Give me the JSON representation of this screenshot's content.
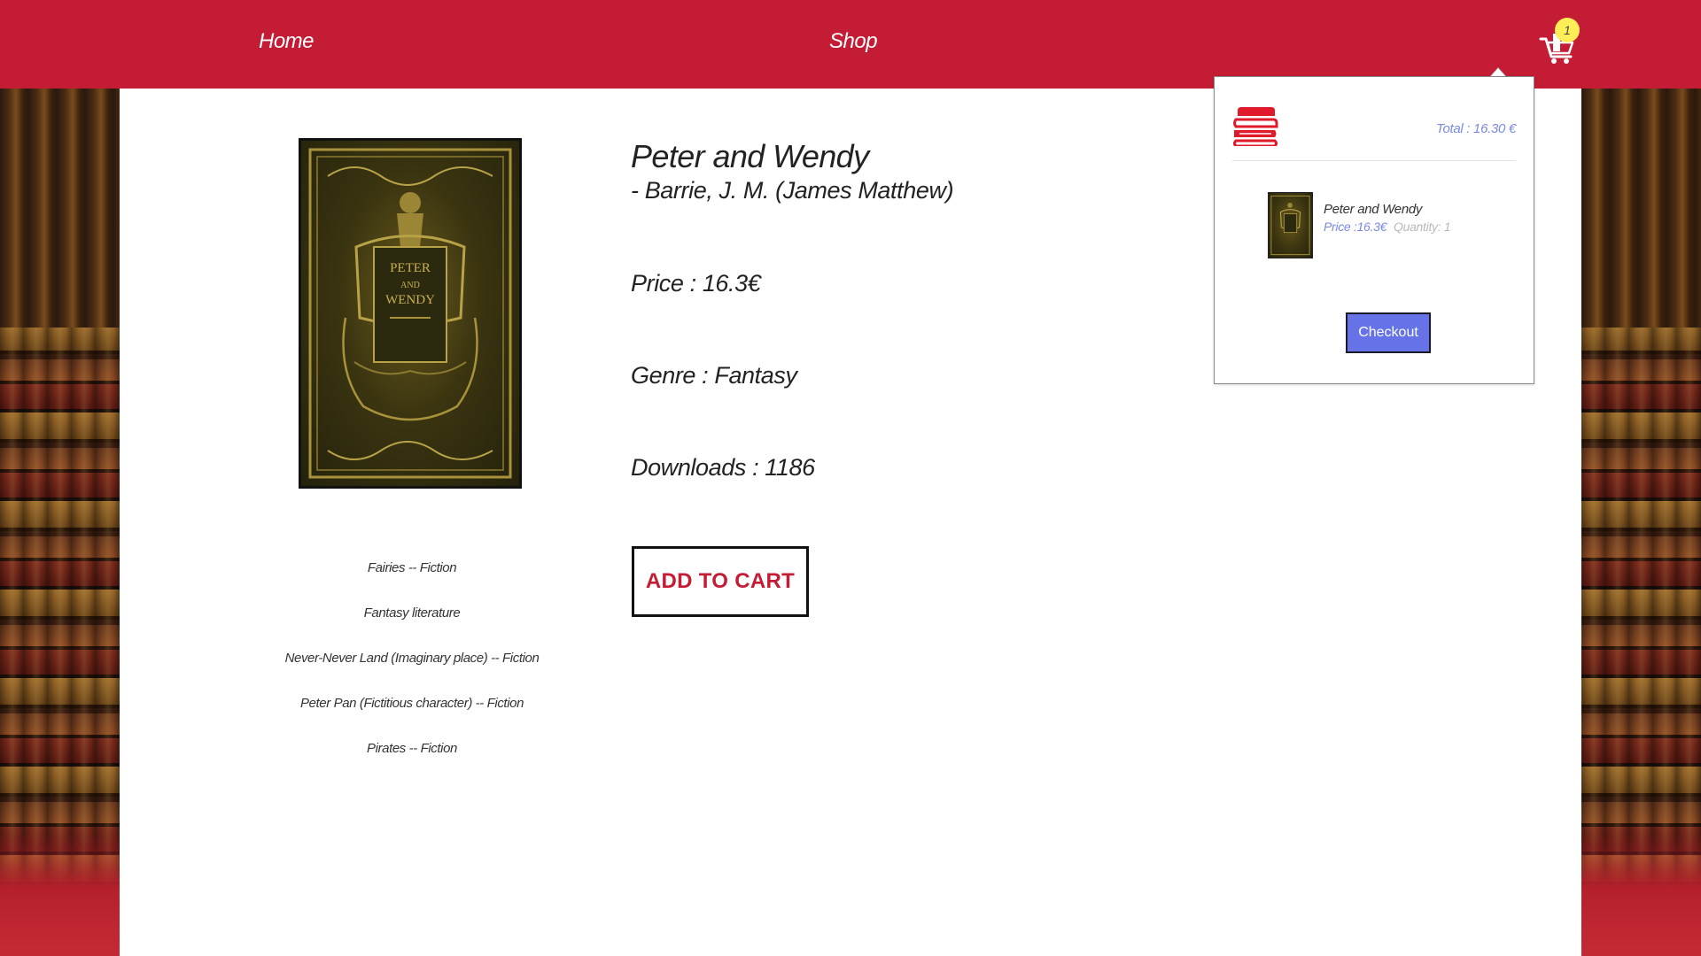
{
  "nav": {
    "home_label": "Home",
    "shop_label": "Shop",
    "cart_count": "1"
  },
  "product": {
    "title": "Peter and Wendy",
    "author": "- Barrie, J. M. (James Matthew)",
    "price": "Price : 16.3€",
    "genre": "Genre : Fantasy",
    "downloads": "Downloads : 1186",
    "add_to_cart_label": "ADD TO CART",
    "cover_lines": [
      "PETER",
      "AND",
      "WENDY"
    ],
    "subjects": [
      "Fairies -- Fiction",
      "Fantasy literature",
      "Never-Never Land (Imaginary place) -- Fiction",
      "Peter Pan (Fictitious character) -- Fiction",
      "Pirates -- Fiction"
    ]
  },
  "cart": {
    "total": "Total : 16.30 €",
    "items": [
      {
        "name": "Peter and Wendy",
        "price": "Price :16.3€",
        "quantity": "Quantity: 1"
      }
    ],
    "checkout_label": "Checkout"
  },
  "colors": {
    "brand_red": "#c41c34",
    "accent_blue": "#6673e8",
    "badge_yellow": "#ffee58",
    "muted_blue_text": "#7a89e6"
  },
  "icons": {
    "cart": "shopping-cart-icon",
    "books": "books-stack-icon"
  }
}
